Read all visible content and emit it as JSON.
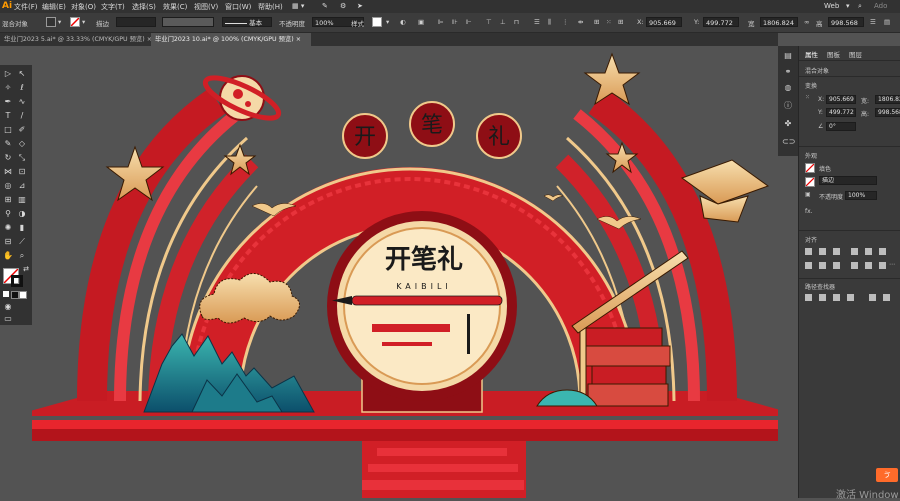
{
  "app": {
    "logo": "Ai"
  },
  "menus": [
    "文件(F)",
    "编辑(E)",
    "对象(O)",
    "文字(T)",
    "选择(S)",
    "效果(C)",
    "视图(V)",
    "窗口(W)",
    "帮助(H)"
  ],
  "window": {
    "workspace": "Web",
    "search_hint": "Ado"
  },
  "control_bar": {
    "selection_label": "混合对象",
    "stroke_label": "描边",
    "stroke_style": "基本",
    "opacity_label": "不透明度",
    "opacity_value": "100%",
    "style_label": "样式",
    "x_value": "905.669",
    "y_value": "499.772",
    "width_label": "宽",
    "width_value": "1806.824",
    "height_label": "高",
    "height_value": "998.568"
  },
  "tabs": [
    {
      "label": "华业门2023 5.ai* @ 33.33% (CMYK/GPU 预览)",
      "active": false
    },
    {
      "label": "毕业门2023 10.ai* @ 100% (CMYK/GPU 预览)",
      "active": true
    }
  ],
  "properties": {
    "tabs": [
      "属性",
      "图板",
      "图层"
    ],
    "selection": "混合对象",
    "transform_title": "变换",
    "x_label": "X:",
    "x": "905.669",
    "y_label": "Y:",
    "y": "499.772",
    "w_label": "宽:",
    "w": "1806.824",
    "h_label": "高:",
    "h": "998.568",
    "angle": "0°",
    "appearance_title": "外观",
    "fill_label": "填色",
    "stroke_label": "描边",
    "opacity_label": "不透明度",
    "opacity_value": "100%",
    "fx_label": "fx.",
    "align_title": "对齐",
    "pathfinder_title": "路径查找器"
  },
  "artwork": {
    "chinese_title": "开笔礼",
    "pinyin": "KAIBILI"
  },
  "notification": {
    "label": "ゔ"
  },
  "watermark": "激活 Window",
  "colors": {
    "red": "#d11f26",
    "dark_red": "#8e0e15",
    "gold": "#f2c98a",
    "dark_bg": "#535353",
    "ui_dark": "#323232"
  }
}
